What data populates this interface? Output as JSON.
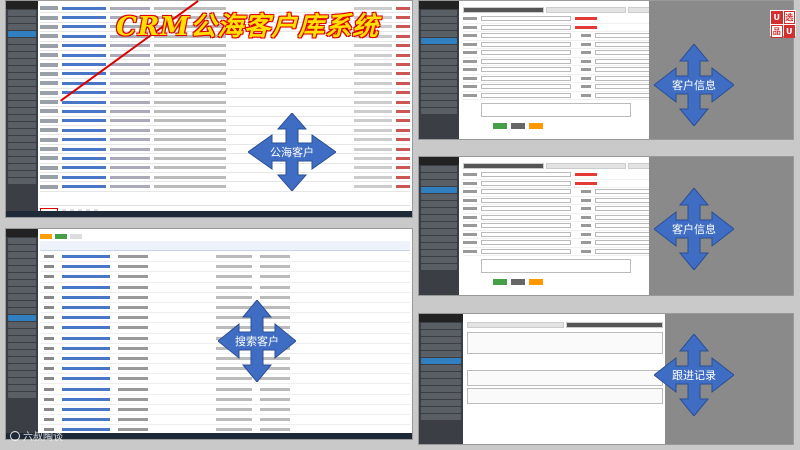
{
  "banner": {
    "title": "CRM公海客户库系统"
  },
  "logo": {
    "chars": [
      "U",
      "选",
      "品",
      "U"
    ]
  },
  "labels": {
    "public_pool": "公海客户",
    "customer_info_1": "客户信息",
    "customer_info_2": "客户信息",
    "search": "搜索客户",
    "followup": "跟进记录"
  },
  "watermark": {
    "text": "六叔陶谈"
  },
  "colors": {
    "arrow": "#3f6dc4",
    "banner_fill": "#ffe000",
    "banner_stroke": "#d00000"
  },
  "icons": [
    "four-way-arrow-icon",
    "logo-icon",
    "watermark-icon"
  ]
}
